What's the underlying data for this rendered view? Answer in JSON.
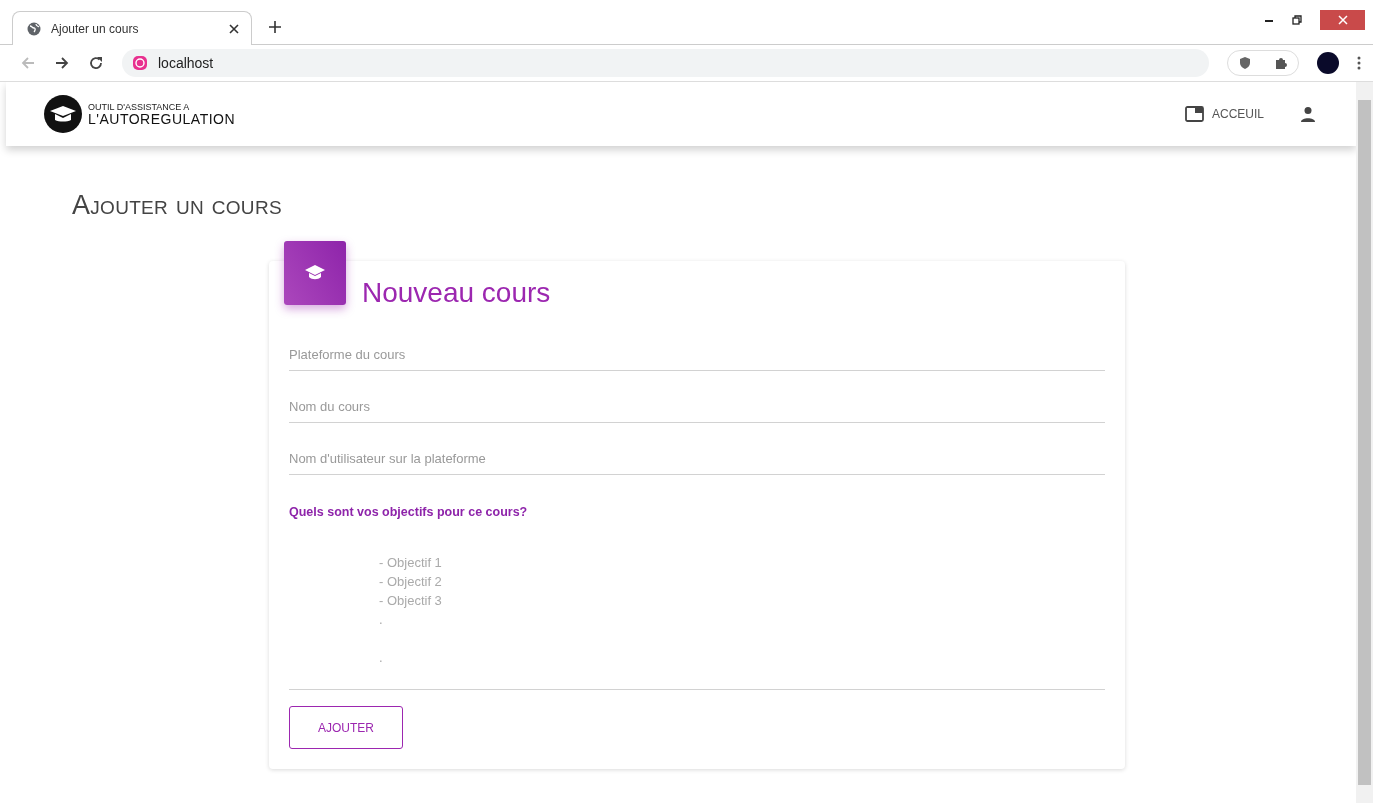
{
  "browser": {
    "tab": {
      "title": "Ajouter un cours",
      "selected": true
    },
    "address": "localhost"
  },
  "navbar": {
    "logo_line_1": "OUTIL D'ASSISTANCE A",
    "logo_line_2": "L'AUTOREGULATION",
    "home_link": "ACCEUIL"
  },
  "page_title": "Ajouter un cours",
  "card": {
    "title": "Nouveau cours",
    "fields": [
      {
        "placeholder": "Plateforme du cours"
      },
      {
        "placeholder": "Nom du cours"
      },
      {
        "placeholder": "Nom d'utilisateur sur la plateforme"
      }
    ],
    "objectives_label": "Quels sont vos objectifs pour ce cours?",
    "objectives_placeholder": "- Objectif 1\n- Objectif 2\n- Objectif 3\n.\n\n.",
    "submit": "AJOUTER"
  }
}
